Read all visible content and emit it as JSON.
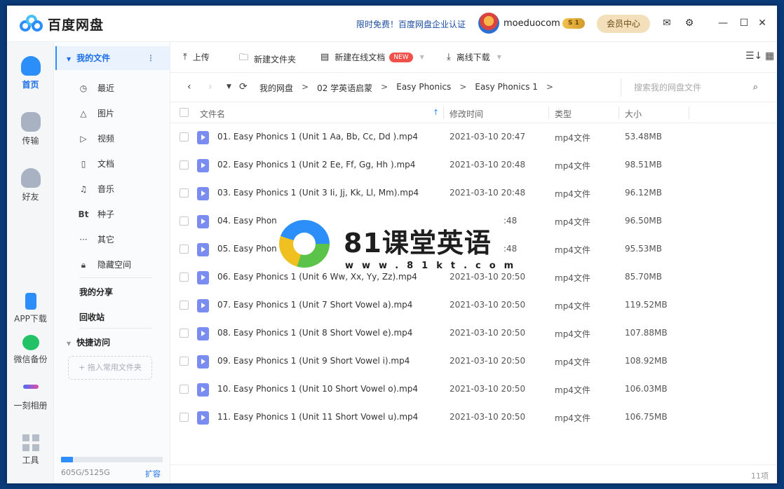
{
  "titlebar": {
    "app_name": "百度网盘",
    "promo": "限时免费！百度网盘企业认证",
    "username": "moeduocom",
    "vip_badge": "S 1",
    "vip_center": "会员中心"
  },
  "leftnav": {
    "home": "首页",
    "transfer": "传输",
    "friends": "好友",
    "app_download": "APP下载",
    "wechat_backup": "微信备份",
    "album": "一刻相册",
    "tools": "工具"
  },
  "sidebar": {
    "my_files": "我的文件",
    "items": [
      {
        "label": "最近",
        "icon": "clock-icon"
      },
      {
        "label": "图片",
        "icon": "image-icon"
      },
      {
        "label": "视频",
        "icon": "video-icon"
      },
      {
        "label": "文档",
        "icon": "document-icon"
      },
      {
        "label": "音乐",
        "icon": "headphones-icon"
      },
      {
        "label": "种子",
        "icon": "torrent-icon"
      },
      {
        "label": "其它",
        "icon": "more-icon"
      },
      {
        "label": "隐藏空间",
        "icon": "lock-icon"
      }
    ],
    "my_share": "我的分享",
    "recycle": "回收站",
    "quick_access": "快捷访问",
    "drag_hint": "+ 拖入常用文件夹",
    "storage_text": "605G/5125G",
    "storage_fraction": 0.118,
    "expand": "扩容"
  },
  "toolbar": {
    "upload": "上传",
    "new_folder": "新建文件夹",
    "new_doc": "新建在线文档",
    "new_badge": "NEW",
    "offline_download": "离线下载"
  },
  "breadcrumb": [
    "我的网盘",
    "02 学英语启蒙",
    "Easy Phonics",
    "Easy Phonics 1"
  ],
  "search": {
    "placeholder": "搜索我的网盘文件"
  },
  "table": {
    "headers": {
      "name": "文件名",
      "time": "修改时间",
      "type": "类型",
      "size": "大小"
    },
    "rows": [
      {
        "name": "01. Easy Phonics 1 (Unit 1 Aa, Bb, Cc, Dd ).mp4",
        "time": "2021-03-10 20:47",
        "type": "mp4文件",
        "size": "53.48MB"
      },
      {
        "name": "02. Easy Phonics 1 (Unit 2 Ee, Ff, Gg, Hh  ).mp4",
        "time": "2021-03-10 20:48",
        "type": "mp4文件",
        "size": "98.51MB"
      },
      {
        "name": "03. Easy Phonics 1 (Unit 3 Ii, Jj, Kk, Ll, Mm).mp4",
        "time": "2021-03-10 20:48",
        "type": "mp4文件",
        "size": "96.12MB"
      },
      {
        "name": "04. Easy Phon",
        "time": ":48",
        "type": "mp4文件",
        "size": "96.50MB"
      },
      {
        "name": "05. Easy Phon",
        "time": ":48",
        "type": "mp4文件",
        "size": "95.53MB"
      },
      {
        "name": "06. Easy Phonics 1 (Unit 6 Ww, Xx, Yy, Zz).mp4",
        "time": "2021-03-10 20:50",
        "type": "mp4文件",
        "size": "85.70MB"
      },
      {
        "name": "07. Easy Phonics 1 (Unit 7 Short Vowel a).mp4",
        "time": "2021-03-10 20:50",
        "type": "mp4文件",
        "size": "119.52MB"
      },
      {
        "name": "08. Easy Phonics 1 (Unit 8 Short Vowel e).mp4",
        "time": "2021-03-10 20:50",
        "type": "mp4文件",
        "size": "107.88MB"
      },
      {
        "name": "09. Easy Phonics 1 (Unit 9 Short Vowel i).mp4",
        "time": "2021-03-10 20:50",
        "type": "mp4文件",
        "size": "108.92MB"
      },
      {
        "name": "10. Easy Phonics 1 (Unit 10 Short Vowel o).mp4",
        "time": "2021-03-10 20:50",
        "type": "mp4文件",
        "size": "106.03MB"
      },
      {
        "name": "11. Easy Phonics 1 (Unit 11 Short Vowel u).mp4",
        "time": "2021-03-10 20:50",
        "type": "mp4文件",
        "size": "106.75MB"
      }
    ]
  },
  "footer": {
    "count": "11项"
  },
  "watermark": {
    "title": "81课堂英语",
    "url": "www.81kt.com"
  },
  "colors": {
    "accent": "#2c8ef8",
    "file_icon": "#7b8cf0",
    "vip": "#f3dfba"
  }
}
